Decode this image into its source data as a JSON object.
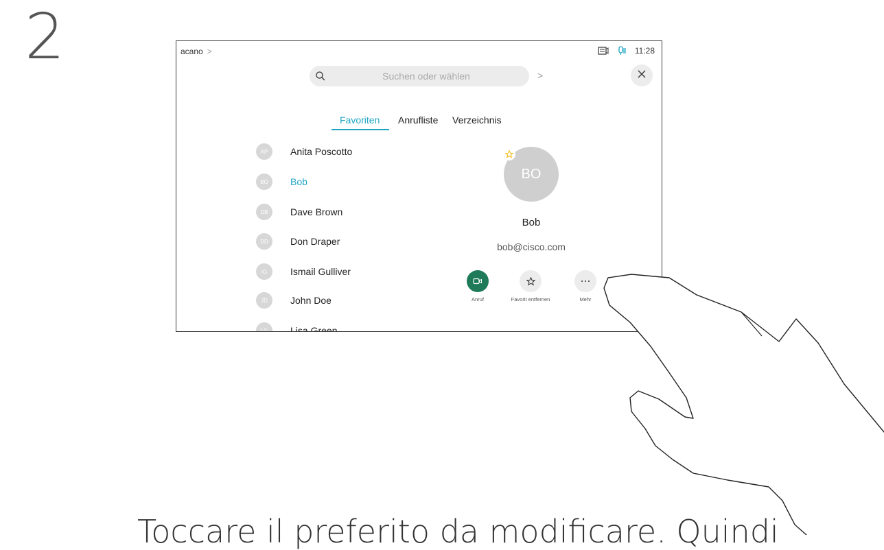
{
  "step": {
    "number": "2"
  },
  "instruction": "Toccare il preferito da modificare. Quindi",
  "topbar": {
    "breadcrumb": "acano",
    "time": "11:28"
  },
  "search": {
    "placeholder": "Suchen oder wählen"
  },
  "tabs": [
    {
      "label": "Favoriten",
      "active": true
    },
    {
      "label": "Anrufliste",
      "active": false
    },
    {
      "label": "Verzeichnis",
      "active": false
    }
  ],
  "contacts": [
    {
      "initials": "AP",
      "name": "Anita Poscotto"
    },
    {
      "initials": "BO",
      "name": "Bob",
      "selected": true
    },
    {
      "initials": "DB",
      "name": "Dave Brown"
    },
    {
      "initials": "DD",
      "name": "Don Draper"
    },
    {
      "initials": "IG",
      "name": "Ismail Gulliver"
    },
    {
      "initials": "JD",
      "name": "John Doe"
    },
    {
      "initials": "LG",
      "name": "Lisa Green"
    }
  ],
  "detail": {
    "initials": "BO",
    "name": "Bob",
    "email": "bob@cisco.com"
  },
  "actions": [
    {
      "label": "Anruf",
      "icon": "video-camera-icon"
    },
    {
      "label": "Favorit entfernen",
      "icon": "star-icon"
    },
    {
      "label": "Mehr",
      "icon": "more-dots-icon"
    }
  ],
  "colors": {
    "accent": "#1fa5c4",
    "call_green": "#1f7a5a",
    "favorite_star": "#f2b705"
  }
}
